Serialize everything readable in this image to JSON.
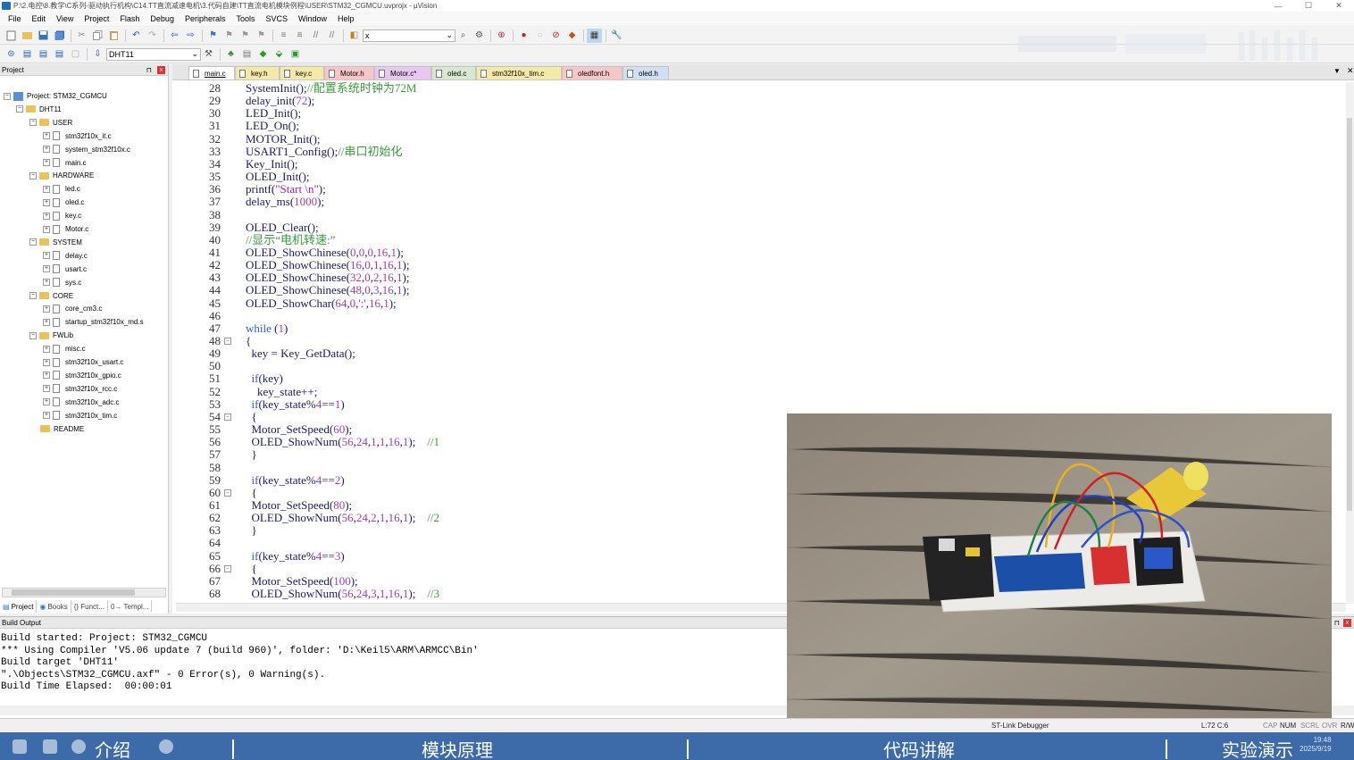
{
  "window": {
    "title": "P:\\2.电控\\8.教学\\C系列-驱动执行机构\\C14.TT直流减速电机\\3.代码自建\\TT直流电机模块例程\\USER\\STM32_CGMCU.uvprojx - µVision",
    "minimize": "—",
    "maximize": "☐",
    "close": "✕"
  },
  "menu": [
    "File",
    "Edit",
    "View",
    "Project",
    "Flash",
    "Debug",
    "Peripherals",
    "Tools",
    "SVCS",
    "Window",
    "Help"
  ],
  "toolbar": {
    "find_value": "x",
    "target_value": "DHT11"
  },
  "project_panel": {
    "title": "Project",
    "pin": "⊓",
    "close": "x",
    "root": "Project: STM32_CGMCU",
    "target": "DHT11",
    "groups": [
      {
        "name": "USER",
        "files": [
          "stm32f10x_it.c",
          "system_stm32f10x.c",
          "main.c"
        ]
      },
      {
        "name": "HARDWARE",
        "files": [
          "led.c",
          "oled.c",
          "key.c",
          "Motor.c"
        ]
      },
      {
        "name": "SYSTEM",
        "files": [
          "delay.c",
          "usart.c",
          "sys.c"
        ]
      },
      {
        "name": "CORE",
        "files": [
          "core_cm3.c",
          "startup_stm32f10x_md.s"
        ]
      },
      {
        "name": "FWLib",
        "files": [
          "misc.c",
          "stm32f10x_usart.c",
          "stm32f10x_gpio.c",
          "stm32f10x_rcc.c",
          "stm32f10x_adc.c",
          "stm32f10x_tim.c"
        ]
      }
    ],
    "readme": "README",
    "tabs": [
      "Project",
      "Books",
      "{} Funct...",
      "0→ Templ..."
    ]
  },
  "editor": {
    "tabs": [
      "main.c",
      "key.h",
      "key.c",
      "Motor.h",
      "Motor.c*",
      "oled.c",
      "stm32f10x_tim.c",
      "oledfont.h",
      "oled.h"
    ],
    "tab_colors": [
      "#ffffff",
      "#f4e9a8",
      "#f4e9a8",
      "#f7c7c7",
      "#e8c8f0",
      "#d8e8d0",
      "#f4e9a8",
      "#f7c7c7",
      "#cfe0f5"
    ],
    "lines": [
      {
        "n": "28",
        "t": "SystemInit();//配置系统时钟为72M"
      },
      {
        "n": "29",
        "t": "delay_init(72);"
      },
      {
        "n": "30",
        "t": "LED_Init();"
      },
      {
        "n": "31",
        "t": "LED_On();"
      },
      {
        "n": "32",
        "t": "MOTOR_Init();"
      },
      {
        "n": "33",
        "t": "USART1_Config();//串口初始化"
      },
      {
        "n": "34",
        "t": "Key_Init();"
      },
      {
        "n": "35",
        "t": "OLED_Init();"
      },
      {
        "n": "36",
        "t": "printf(\"Start \\n\");"
      },
      {
        "n": "37",
        "t": "delay_ms(1000);"
      },
      {
        "n": "38",
        "t": ""
      },
      {
        "n": "39",
        "t": "OLED_Clear();"
      },
      {
        "n": "40",
        "t": "//显示“电机转速:”"
      },
      {
        "n": "41",
        "t": "OLED_ShowChinese(0,0,0,16,1);"
      },
      {
        "n": "42",
        "t": "OLED_ShowChinese(16,0,1,16,1);"
      },
      {
        "n": "43",
        "t": "OLED_ShowChinese(32,0,2,16,1);"
      },
      {
        "n": "44",
        "t": "OLED_ShowChinese(48,0,3,16,1);"
      },
      {
        "n": "45",
        "t": "OLED_ShowChar(64,0,':',16,1);"
      },
      {
        "n": "46",
        "t": ""
      },
      {
        "n": "47",
        "t": "while (1)"
      },
      {
        "n": "48",
        "t": "{"
      },
      {
        "n": "49",
        "t": "  key = Key_GetData();"
      },
      {
        "n": "50",
        "t": ""
      },
      {
        "n": "51",
        "t": "  if(key)"
      },
      {
        "n": "52",
        "t": "    key_state++;"
      },
      {
        "n": "53",
        "t": "  if(key_state%4==1)"
      },
      {
        "n": "54",
        "t": "  {"
      },
      {
        "n": "55",
        "t": "  Motor_SetSpeed(60);"
      },
      {
        "n": "56",
        "t": "  OLED_ShowNum(56,24,1,1,16,1);    //1"
      },
      {
        "n": "57",
        "t": "  }"
      },
      {
        "n": "58",
        "t": ""
      },
      {
        "n": "59",
        "t": "  if(key_state%4==2)"
      },
      {
        "n": "60",
        "t": "  {"
      },
      {
        "n": "61",
        "t": "  Motor_SetSpeed(80);"
      },
      {
        "n": "62",
        "t": "  OLED_ShowNum(56,24,2,1,16,1);    //2"
      },
      {
        "n": "63",
        "t": "  }"
      },
      {
        "n": "64",
        "t": ""
      },
      {
        "n": "65",
        "t": "  if(key_state%4==3)"
      },
      {
        "n": "66",
        "t": "  {"
      },
      {
        "n": "67",
        "t": "  Motor_SetSpeed(100);"
      },
      {
        "n": "68",
        "t": "  OLED_ShowNum(56,24,3,1,16,1);    //3"
      }
    ],
    "fold_marks": [
      "48",
      "54",
      "60",
      "66"
    ]
  },
  "build_output": {
    "title": "Build Output",
    "lines": [
      "Build started: Project: STM32_CGMCU",
      "*** Using Compiler 'V5.06 update 7 (build 960)', folder: 'D:\\Keil5\\ARM\\ARMCC\\Bin'",
      "Build target 'DHT11'",
      "\".\\Objects\\STM32_CGMCU.axf\" - 0 Error(s), 0 Warning(s).",
      "Build Time Elapsed:  00:00:01"
    ]
  },
  "status": {
    "debugger": "ST-Link Debugger",
    "position": "L:72 C:6",
    "cap": "CAP",
    "num": "NUM",
    "scrl": "SCRL",
    "ovr": "OVR",
    "rw": "R/W"
  },
  "taskbar": {
    "sections": [
      "介绍",
      "模块原理",
      "代码讲解",
      "实验演示"
    ],
    "time": "19:48",
    "date": "2025/9/19"
  },
  "colors": {
    "keyword": "#2f5dbf",
    "comment": "#3a9a3a",
    "string": "#a020a0",
    "number": "#9a3fb0",
    "taskbar": "#3d6aa8"
  }
}
